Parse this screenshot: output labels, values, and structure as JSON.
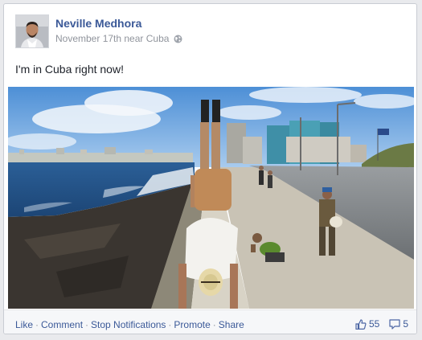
{
  "post": {
    "author": "Neville Medhora",
    "date": "November 17th near Cuba",
    "audience_icon": "globe-icon",
    "status_text": "I'm in Cuba right now!"
  },
  "actions": {
    "like": "Like",
    "comment": "Comment",
    "stop_notifications": "Stop Notifications",
    "promote": "Promote",
    "share": "Share",
    "separator": "·"
  },
  "counts": {
    "likes": "55",
    "comments": "5",
    "like_icon": "thumbs-up-icon",
    "comment_icon": "comment-bubble-icon"
  },
  "colors": {
    "link": "#3b5998",
    "meta_text": "#90949c",
    "footer_bg": "#f6f7f9",
    "page_bg": "#e9eaed"
  }
}
